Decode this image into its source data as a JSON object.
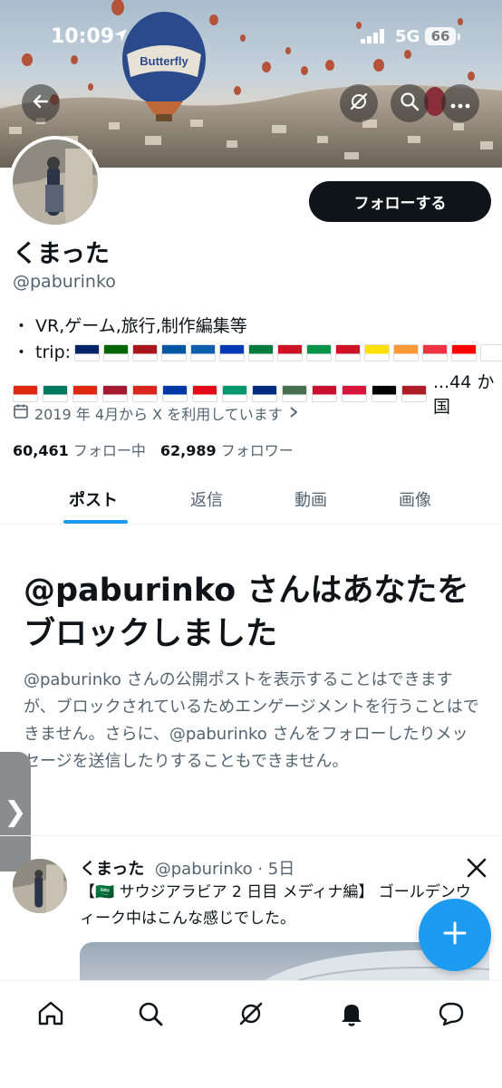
{
  "status_bar": {
    "time": "10:09",
    "network": "5G",
    "battery": "66"
  },
  "header": {
    "back_icon": "back-arrow-icon",
    "grok_icon": "grok-icon",
    "search_icon": "search-icon",
    "more_icon": "more-icon"
  },
  "profile": {
    "follow_button": "フォローする",
    "name": "くまった",
    "handle": "@paburinko",
    "bio_line1": "・ VR,ゲーム,旅行,制作編集等",
    "bio_line2_prefix": "・ trip:",
    "flags_line1": [
      "#012169",
      "#006600",
      "#aa151b",
      "#0055a4",
      "#0d5eaf",
      "#0038b8",
      "#007a3d",
      "#ce1126",
      "#009246",
      "#ce1126",
      "#ffe000",
      "#ff9933",
      "#ef3340",
      "#fe0000",
      "#ffffff"
    ],
    "flags_line2": [
      "#de2910",
      "#00785e",
      "#de2910",
      "#a51931",
      "#da251d",
      "#0038a8",
      "#e30a17",
      "#00966e",
      "#002b7f",
      "#477050",
      "#c8102e",
      "#dc143c",
      "#000000",
      "#ae1c28"
    ],
    "countries_count": "...44 か国",
    "joined": "2019 年 4月から X を利用しています",
    "following_count": "60,461",
    "following_label": "フォロー中",
    "followers_count": "62,989",
    "followers_label": "フォロワー"
  },
  "tabs": [
    {
      "label": "ポスト",
      "active": true
    },
    {
      "label": "返信",
      "active": false
    },
    {
      "label": "動画",
      "active": false
    },
    {
      "label": "画像",
      "active": false
    }
  ],
  "blocked": {
    "title": "@paburinko さんはあなたをブロックしました",
    "description": "@paburinko さんの公開ポストを表示することはできますが、ブロックされているためエンゲージメントを行うことはできません。さらに、@paburinko さんをフォローしたりメッセージを送信したりすることもできません。"
  },
  "tweet": {
    "name": "くまった",
    "handle_time": "@paburinko · 5日",
    "text": "【🇸🇦 サウジアラビア  2 日目  メディナ編】 ゴールデンウィーク中はこんな感じでした。"
  },
  "side_handle": "❯",
  "bottom_nav": [
    "home-icon",
    "search-icon",
    "grok-icon",
    "notifications-icon",
    "messages-icon"
  ],
  "colors": {
    "accent": "#1d9bf0",
    "text": "#0f1419",
    "secondary": "#536471"
  }
}
